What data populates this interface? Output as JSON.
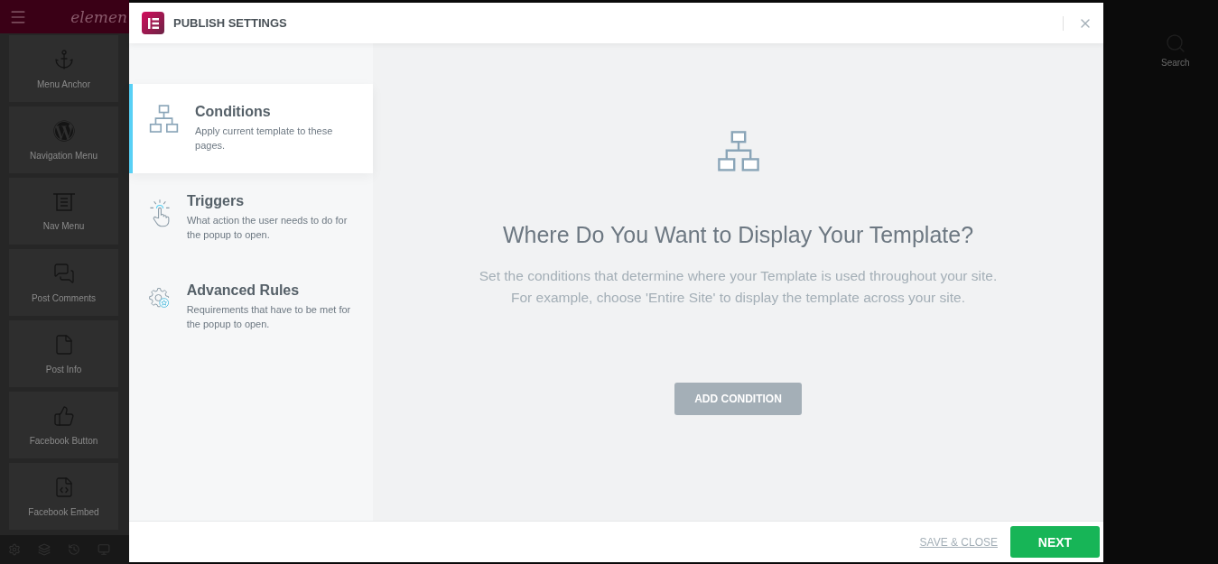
{
  "sidebar": {
    "logo": "elemen",
    "widgets": [
      {
        "label": "Menu Anchor",
        "kind": "anchor"
      },
      {
        "label": "Navigation Menu",
        "kind": "wordpress"
      },
      {
        "label": "Nav Menu",
        "kind": "navmenu"
      },
      {
        "label": "Post Comments",
        "kind": "comments"
      },
      {
        "label": "Post Info",
        "kind": "postinfo"
      },
      {
        "label": "Facebook Button",
        "kind": "like"
      },
      {
        "label": "Facebook Embed",
        "kind": "embed"
      }
    ]
  },
  "background": {
    "search_label": "Search"
  },
  "dialog": {
    "title": "PUBLISH SETTINGS",
    "tabs": [
      {
        "kind": "conditions",
        "title": "Conditions",
        "description": "Apply current template to these pages.",
        "selected": true
      },
      {
        "kind": "triggers",
        "title": "Triggers",
        "description": "What action the user needs to do for the popup to open.",
        "selected": false
      },
      {
        "kind": "rules",
        "title": "Advanced Rules",
        "description": "Requirements that have to be met for the popup to open.",
        "selected": false
      }
    ],
    "heading": "Where Do You Want to Display Your Template?",
    "description": [
      "Set the conditions that determine where your Template is used throughout your site.",
      "For example, choose 'Entire Site' to display the template across your site."
    ],
    "add_button": "ADD CONDITION",
    "save_link": "SAVE & CLOSE",
    "next_button": "NEXT"
  }
}
